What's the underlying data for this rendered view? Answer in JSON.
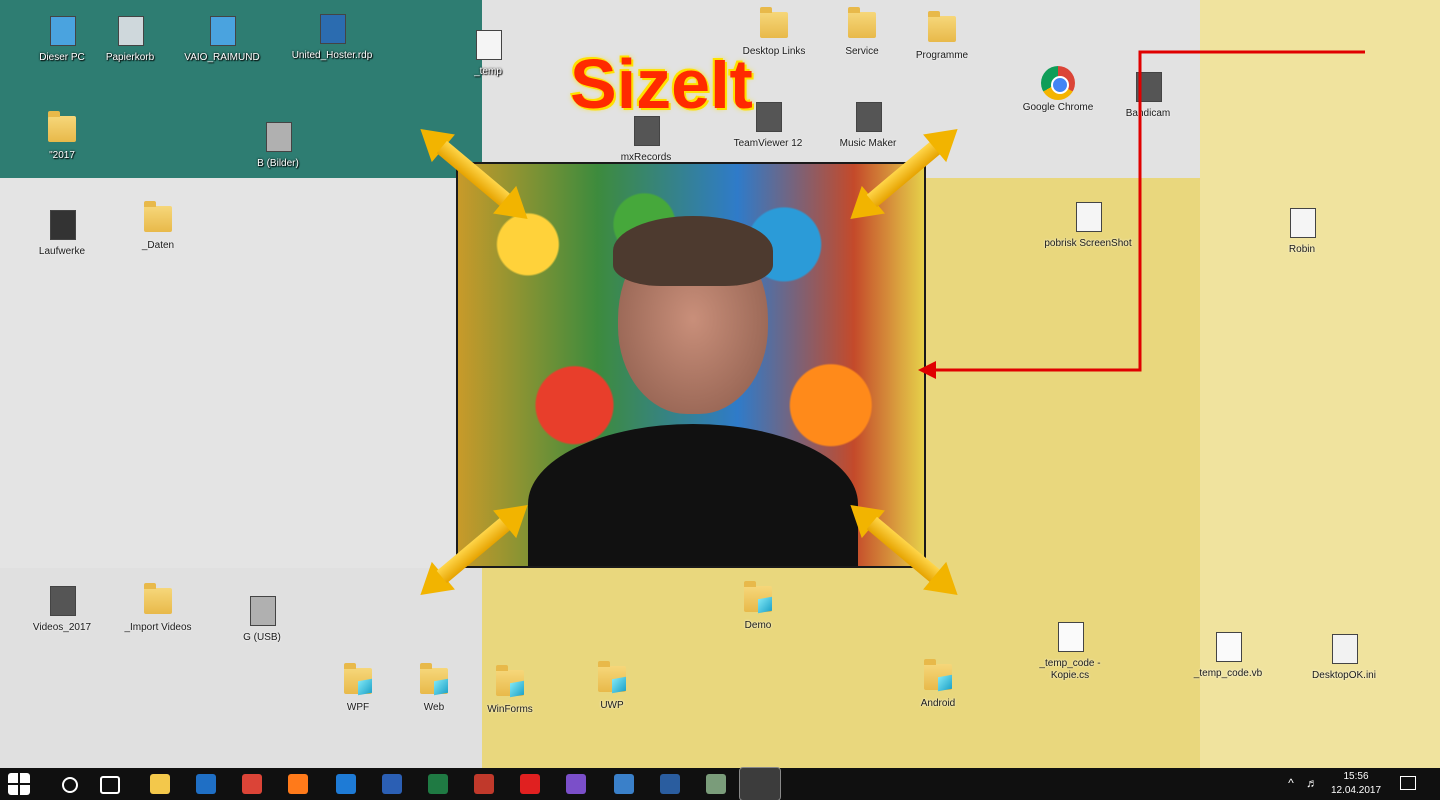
{
  "headline": "SizeIt",
  "desktop": {
    "icons": [
      {
        "label": "Dieser PC",
        "type": "pc"
      },
      {
        "label": "Papierkorb",
        "type": "bin"
      },
      {
        "label": "VAIO_RAIMUND",
        "type": "pc"
      },
      {
        "label": "United_Hoster.rdp",
        "type": "rdp"
      },
      {
        "label": "_temp",
        "type": "file"
      },
      {
        "label": "Desktop Links",
        "type": "folder"
      },
      {
        "label": "Service",
        "type": "folder"
      },
      {
        "label": "Programme",
        "type": "folder"
      },
      {
        "label": "Google Chrome",
        "type": "chrome"
      },
      {
        "label": "Bandicam",
        "type": "app"
      },
      {
        "label": "\"2017",
        "type": "folder"
      },
      {
        "label": "B (Bilder)",
        "type": "drive"
      },
      {
        "label": "mxRecords",
        "type": "app"
      },
      {
        "label": "TeamViewer 12",
        "type": "app"
      },
      {
        "label": "Music Maker",
        "type": "app"
      },
      {
        "label": "Laufwerke",
        "type": "server"
      },
      {
        "label": "_Daten",
        "type": "folder"
      },
      {
        "label": "pobrisk ScreenShot",
        "type": "file"
      },
      {
        "label": "Robin",
        "type": "file"
      },
      {
        "label": "Videos_2017",
        "type": "app"
      },
      {
        "label": "_Import Videos",
        "type": "folder"
      },
      {
        "label": "G (USB)",
        "type": "drive"
      },
      {
        "label": "Demo",
        "type": "folder3d"
      },
      {
        "label": "_temp_code - Kopie.cs",
        "type": "code"
      },
      {
        "label": "_temp_code.vb",
        "type": "code"
      },
      {
        "label": "DesktopOK.ini",
        "type": "ini"
      },
      {
        "label": "WPF",
        "type": "folder3d"
      },
      {
        "label": "Web",
        "type": "folder3d"
      },
      {
        "label": "WinForms",
        "type": "folder3d"
      },
      {
        "label": "UWP",
        "type": "folder3d"
      },
      {
        "label": "Android",
        "type": "folder3d"
      }
    ]
  },
  "taskbar": {
    "time": "15:56",
    "date": "12.04.2017",
    "items": [
      "start",
      "search",
      "task-view",
      "explorer",
      "outlook",
      "chrome",
      "firefox",
      "edge",
      "word",
      "excel",
      "app",
      "record",
      "visual-studio",
      "network",
      "edit",
      "monitor",
      "active-app"
    ]
  },
  "colors": {
    "teal": "#2e7d72",
    "yellow_zone": "#e9d77d",
    "yellow_light": "#f0e39e",
    "arrow": "#f2b400",
    "headline": "#ff2a00"
  }
}
